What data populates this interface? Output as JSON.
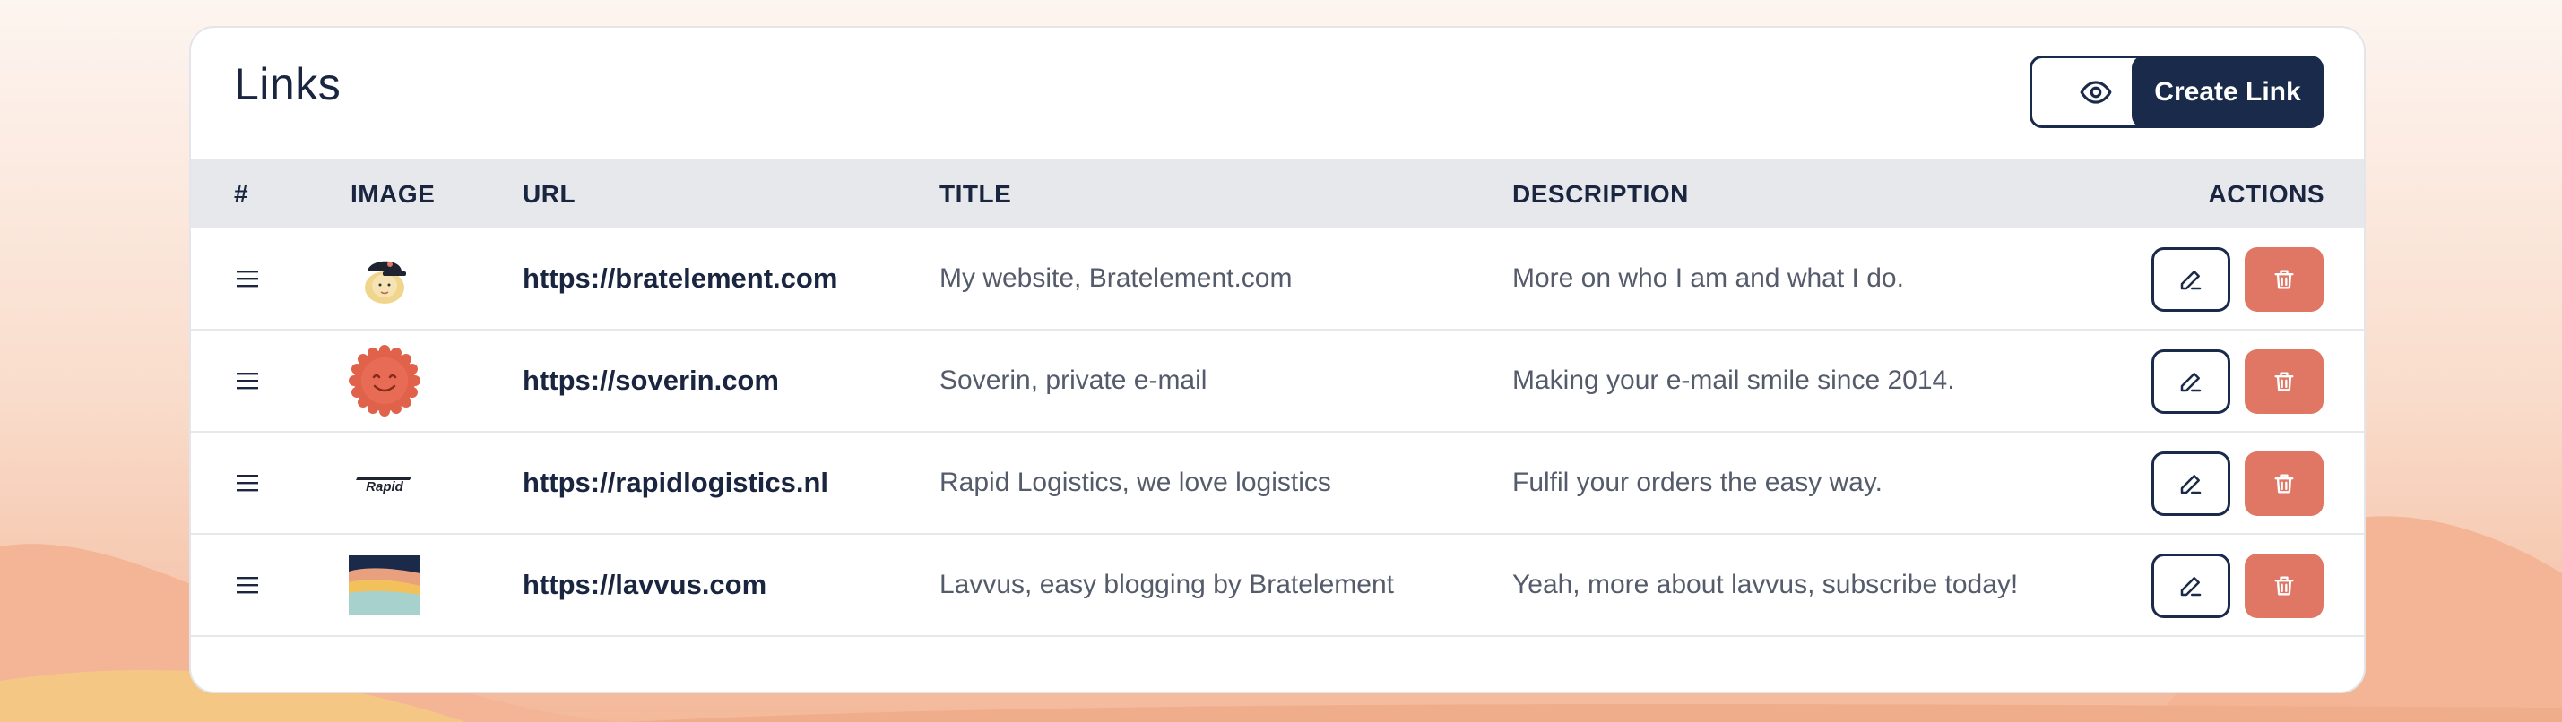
{
  "page": {
    "title": "Links",
    "create_button_label": "Create Link",
    "preview_icon": "eye-icon"
  },
  "table": {
    "headers": {
      "index": "#",
      "image": "IMAGE",
      "url": "URL",
      "title": "TITLE",
      "description": "DESCRIPTION",
      "actions": "ACTIONS"
    },
    "rows": [
      {
        "image_icon": "avatar-cap-icon",
        "url": "https://bratelement.com",
        "title": "My website, Bratelement.com",
        "description": "More on who I am and what I do."
      },
      {
        "image_icon": "smiley-seal-icon",
        "url": "https://soverin.com",
        "title": "Soverin, private e-mail",
        "description": "Making your e-mail smile since 2014."
      },
      {
        "image_icon": "rapid-logo-icon",
        "image_text": "Rapid",
        "url": "https://rapidlogistics.nl",
        "title": "Rapid Logistics, we love logistics",
        "description": "Fulfil your orders the easy way."
      },
      {
        "image_icon": "landscape-stripes-icon",
        "url": "https://lavvus.com",
        "title": "Lavvus, easy blogging by Bratelement",
        "description": "Yeah, more about lavvus, subscribe today!"
      }
    ],
    "row_actions": {
      "edit_icon": "pencil-icon",
      "delete_icon": "trash-icon"
    }
  },
  "colors": {
    "primary": "#1a2a4a",
    "danger": "#e07664",
    "header_bg": "#e6e8ec",
    "background_peach": "#f4b99b"
  }
}
